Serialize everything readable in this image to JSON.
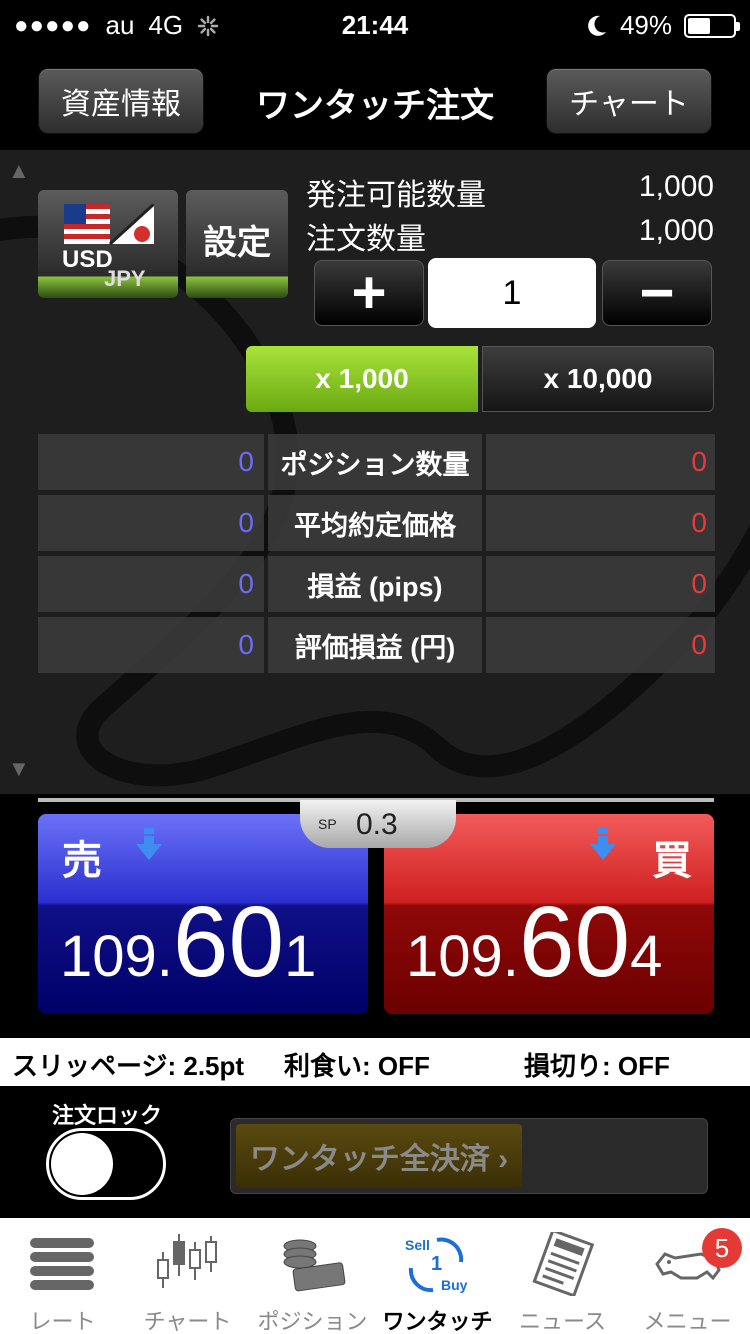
{
  "status_bar": {
    "carrier": "au",
    "network": "4G",
    "time": "21:44",
    "battery": "49%",
    "battery_level": 0.49
  },
  "header": {
    "asset_button": "資産情報",
    "title": "ワンタッチ注文",
    "chart_button": "チャート"
  },
  "currency_pair": {
    "base": "USD",
    "quote": "JPY",
    "icon": "us-jp-flag-icon"
  },
  "settings_button": "設定",
  "order_info": {
    "available_label": "発注可能数量",
    "available_value": "1,000",
    "order_label": "注文数量",
    "order_value": "1,000"
  },
  "quantity": {
    "plus": "+",
    "value": "1",
    "minus": "−"
  },
  "multipliers": [
    {
      "label": "x 1,000",
      "selected": true
    },
    {
      "label": "x 10,000",
      "selected": false
    }
  ],
  "positions": [
    {
      "label": "ポジション数量",
      "sell": "0",
      "buy": "0"
    },
    {
      "label": "平均約定価格",
      "sell": "0",
      "buy": "0"
    },
    {
      "label": "損益 (pips)",
      "sell": "0",
      "buy": "0"
    },
    {
      "label": "評価損益 (円)",
      "sell": "0",
      "buy": "0"
    }
  ],
  "spread": {
    "label": "SP",
    "value": "0.3"
  },
  "sell": {
    "label": "売",
    "rate_prefix": "109.",
    "rate_big": "60",
    "rate_suffix": "1",
    "color": "#2b2fd0"
  },
  "buy": {
    "label": "買",
    "rate_prefix": "109.",
    "rate_big": "60",
    "rate_suffix": "4",
    "color": "#cf2020"
  },
  "order_settings": {
    "slippage": "スリッページ: 2.5pt",
    "take_profit": "利食い: OFF",
    "stop_loss": "損切り: OFF"
  },
  "order_lock": {
    "label": "注文ロック",
    "enabled": false
  },
  "close_all_button": "ワンタッチ全決済 ›",
  "tabs": [
    {
      "label": "レート",
      "icon": "rate-list-icon"
    },
    {
      "label": "チャート",
      "icon": "candlestick-icon"
    },
    {
      "label": "ポジション",
      "icon": "coins-icon"
    },
    {
      "label": "ワンタッチ",
      "icon": "sell-buy-icon",
      "selected": true
    },
    {
      "label": "ニュース",
      "icon": "newspaper-icon"
    },
    {
      "label": "メニュー",
      "icon": "cymo-rhino-icon",
      "badge": "5"
    }
  ],
  "colors": {
    "accent_green": "#8cc63f",
    "sell_blue": "#2b2fd0",
    "buy_red": "#cf2020",
    "position_sell_text": "#6c6cf5",
    "position_buy_text": "#e83a3a"
  }
}
